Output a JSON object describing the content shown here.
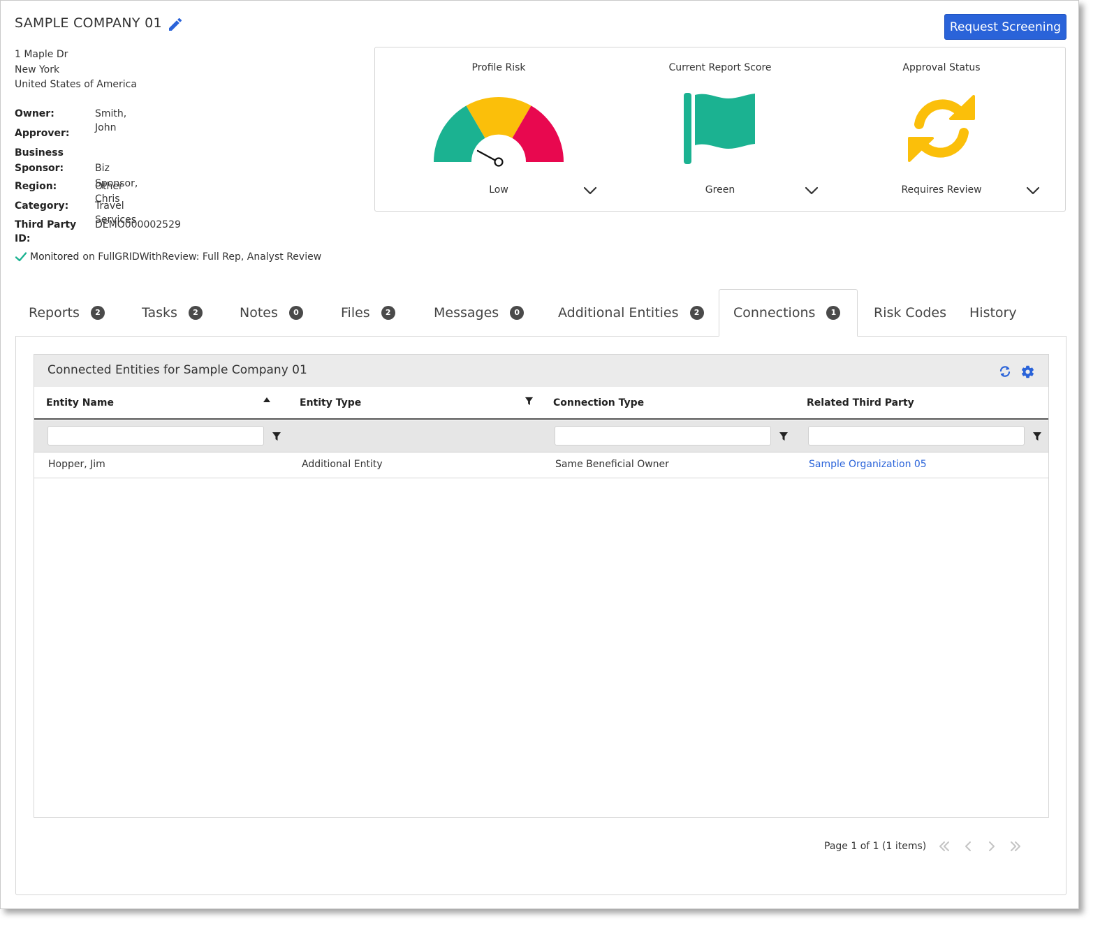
{
  "company": {
    "title": "SAMPLE COMPANY 01",
    "address": [
      "1 Maple Dr",
      "New York",
      "United States of America"
    ],
    "request_button": "Request Screening"
  },
  "details": {
    "owner_label": "Owner:",
    "owner_value": "Smith, John",
    "approver_label": "Approver:",
    "approver_value": "",
    "sponsor_label_1": "Business",
    "sponsor_label_2": "Sponsor:",
    "sponsor_value": "Biz Sponsor, Chris",
    "region_label": "Region:",
    "region_value": "Other",
    "category_label": "Category:",
    "category_value": "Travel Services",
    "tpid_label": "Third Party ID:",
    "tpid_value": "DEMO000002529"
  },
  "monitoring": {
    "status": "Monitored",
    "detail": "on FullGRIDWithReview: Full Rep, Analyst Review"
  },
  "scores": {
    "profile_risk": {
      "title": "Profile Risk",
      "value": "Low",
      "colors": [
        "#1bb291",
        "#fbbf0a",
        "#e8084f"
      ]
    },
    "report_score": {
      "title": "Current Report Score",
      "value": "Green",
      "color": "#1bb291"
    },
    "approval": {
      "title": "Approval Status",
      "value": "Requires Review",
      "color": "#fbbf0a"
    }
  },
  "tabs": [
    {
      "label": "Reports",
      "count": "2"
    },
    {
      "label": "Tasks",
      "count": "2"
    },
    {
      "label": "Notes",
      "count": "0"
    },
    {
      "label": "Files",
      "count": "2"
    },
    {
      "label": "Messages",
      "count": "0"
    },
    {
      "label": "Additional Entities",
      "count": "2"
    },
    {
      "label": "Connections",
      "count": "1"
    },
    {
      "label": "Risk Codes",
      "count": ""
    },
    {
      "label": "History",
      "count": ""
    }
  ],
  "active_tab": "Connections",
  "grid": {
    "title": "Connected Entities for Sample Company 01",
    "columns": [
      "Entity Name",
      "Entity Type",
      "Connection Type",
      "Related Third Party"
    ],
    "rows": [
      [
        "Hopper, Jim",
        "Additional Entity",
        "Same Beneficial Owner",
        "Sample Organization 05"
      ]
    ],
    "pager_text": "Page 1 of 1 (1 items)"
  },
  "colors": {
    "accent": "#2a63d9",
    "badge": "#4a4a4a"
  }
}
